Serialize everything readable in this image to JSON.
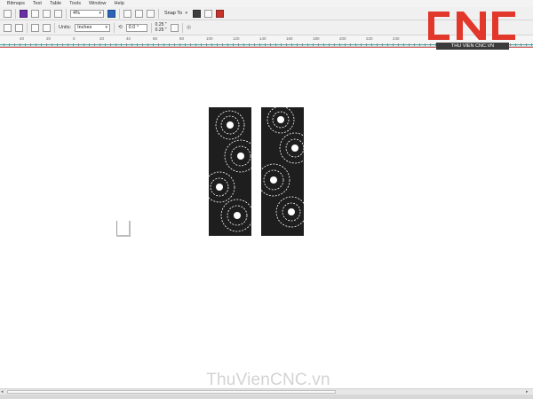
{
  "menubar": [
    "Bitmaps",
    "Text",
    "Table",
    "Tools",
    "Window",
    "Help"
  ],
  "toolbar1": {
    "zoom_value": "4%",
    "snap_label": "Snap To"
  },
  "toolbar2": {
    "units_label": "Units:",
    "units_value": "Inches",
    "angle_value": "0.0 °",
    "nudge_x": "0.25 \"",
    "nudge_y": "0.25 \""
  },
  "ruler": {
    "numbers": [
      "40",
      "20",
      "0",
      "20",
      "40",
      "60",
      "80",
      "100",
      "120",
      "140",
      "160",
      "180",
      "200",
      "220",
      "240"
    ]
  },
  "logo": {
    "main_text": "CNC",
    "sub_text": "THU VIEN CNC.VN",
    "color": "#e2372b"
  },
  "watermark": "ThuVienCNC.vn"
}
